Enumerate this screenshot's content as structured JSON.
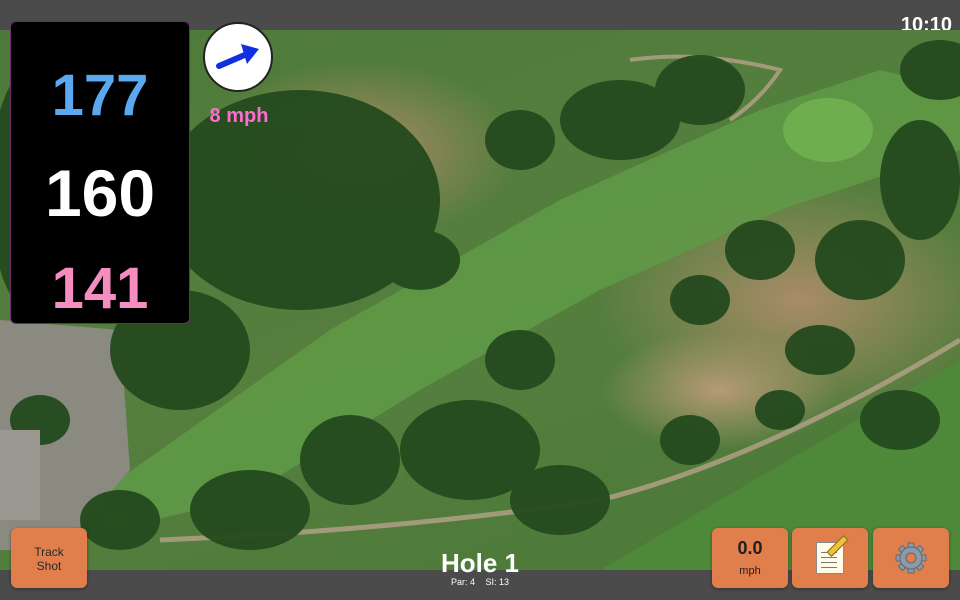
{
  "status_bar": {
    "time": "10:10"
  },
  "yardage": {
    "back": "177",
    "middle": "160",
    "front": "141"
  },
  "wind": {
    "speed": "8 mph",
    "direction_icon": "arrow-east-northeast"
  },
  "buttons": {
    "track_shot_line1": "Track",
    "track_shot_line2": "Shot",
    "speed_value": "0.0",
    "speed_unit": "mph",
    "notes_icon": "notepad-icon",
    "settings_icon": "gear-icon"
  },
  "hole": {
    "title": "Hole 1",
    "par": "Par: 4",
    "si": "SI: 13"
  },
  "colors": {
    "back_yardage": "#5aa8f0",
    "middle_yardage": "#ffffff",
    "front_yardage": "#f58dc0",
    "wind_speed": "#ff6bd0",
    "button": "#e07f4b"
  }
}
